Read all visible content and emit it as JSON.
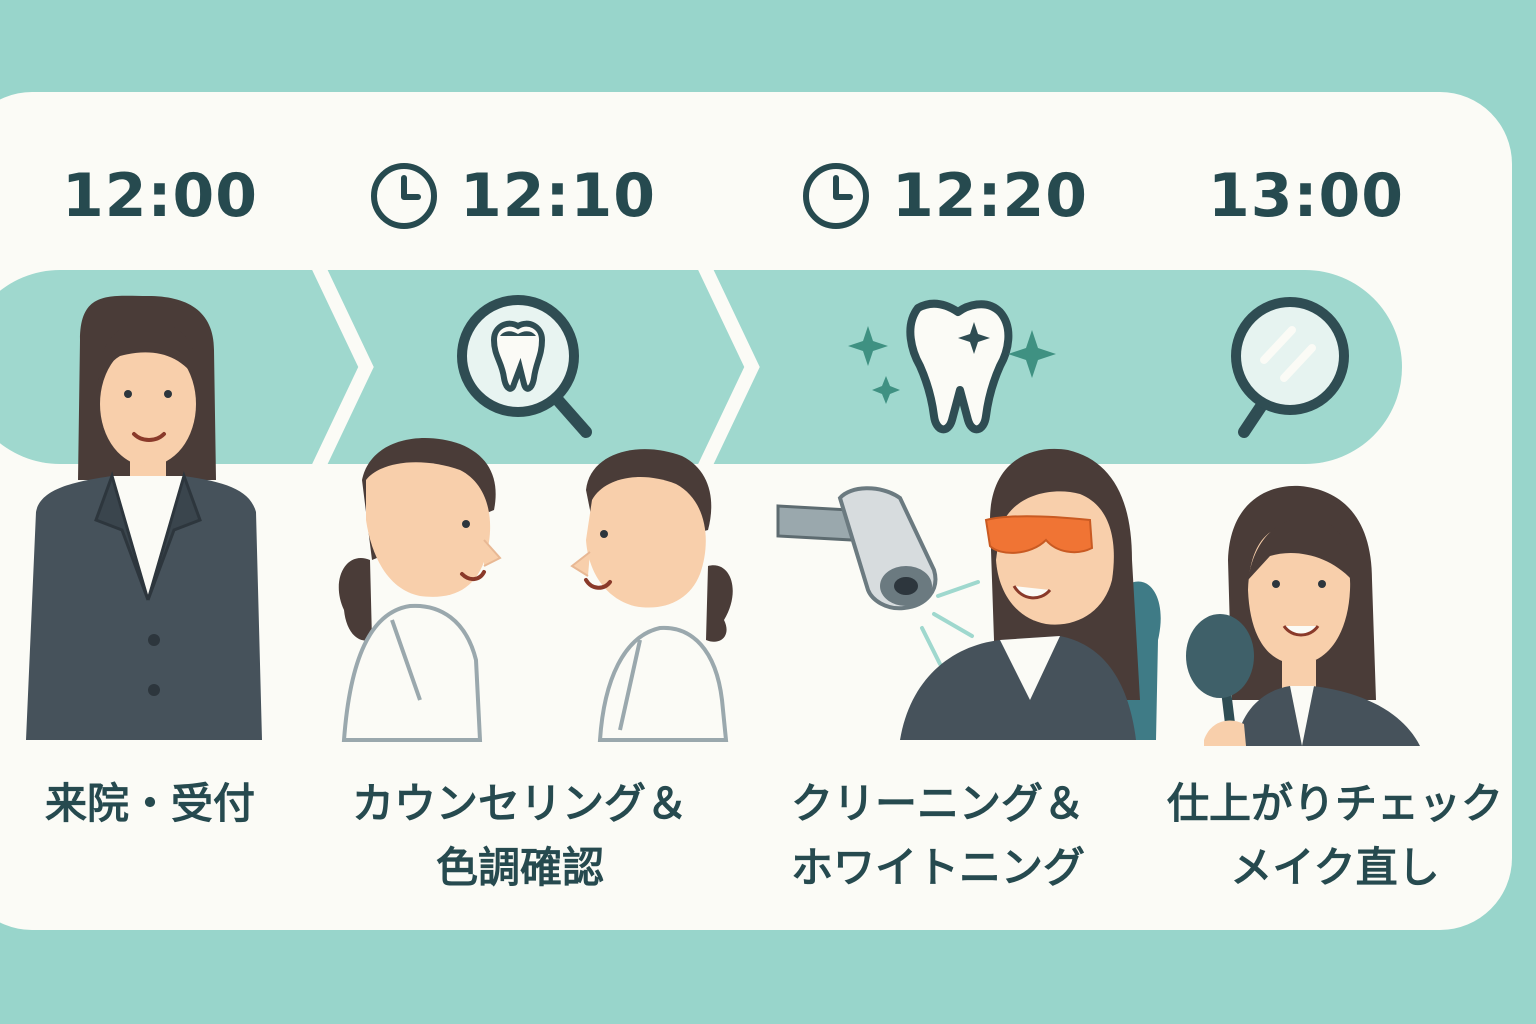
{
  "colors": {
    "background": "#98d5cb",
    "card": "#fbfbf6",
    "band": "#9fd8ce",
    "text": "#264a4f",
    "suit": "#46525b",
    "hair": "#4a3c38",
    "skin": "#f8cfab",
    "goggles": "#f07434"
  },
  "steps": [
    {
      "time": "12:00",
      "clock_icon": false,
      "icon": "person-icon",
      "label_lines": [
        "来院・受付"
      ]
    },
    {
      "time": "12:10",
      "clock_icon": true,
      "icon": "tooth-magnifier-icon",
      "label_lines": [
        "カウンセリング＆",
        "色調確認"
      ]
    },
    {
      "time": "12:20",
      "clock_icon": true,
      "icon": "sparkling-tooth-icon",
      "label_lines": [
        "クリーニング＆",
        "ホワイトニング"
      ]
    },
    {
      "time": "13:00",
      "clock_icon": false,
      "icon": "hand-mirror-icon",
      "label_lines": [
        "仕上がりチェック",
        "メイク直し"
      ]
    }
  ]
}
